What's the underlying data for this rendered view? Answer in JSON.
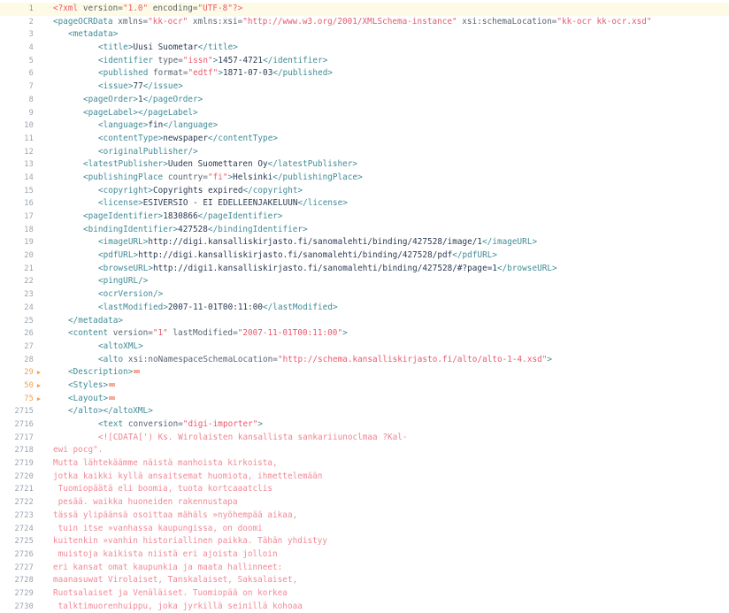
{
  "editor": {
    "name": "xml-code-viewer",
    "language": "XML",
    "active_line": 1,
    "colors": {
      "background": "#ffffff",
      "active_line_background": "#fdfbe6",
      "gutter_text": "#9aa3ad",
      "folded_gutter_text": "#f0a14a",
      "tag": "#3f8b96",
      "attribute_name": "#5a6470",
      "attribute_value": "#e8596b",
      "text_content": "#2b3a52",
      "raw_text": "#f08a96"
    }
  },
  "lines": [
    {
      "number": "1",
      "active": true,
      "folded": false,
      "indent": 0,
      "tokens": [
        {
          "t": "pi",
          "s": "<?xml "
        },
        {
          "t": "attr",
          "s": "version="
        },
        {
          "t": "val",
          "s": "\"1.0\""
        },
        {
          "t": "attr",
          "s": " encoding="
        },
        {
          "t": "val",
          "s": "\"UTF-8\""
        },
        {
          "t": "pi",
          "s": "?>"
        }
      ]
    },
    {
      "number": "2",
      "active": false,
      "folded": false,
      "indent": 0,
      "tokens": [
        {
          "t": "tag",
          "s": "<pageOCRData "
        },
        {
          "t": "attr",
          "s": "xmlns="
        },
        {
          "t": "val",
          "s": "\"kk-ocr\""
        },
        {
          "t": "attr",
          "s": " xmlns:xsi="
        },
        {
          "t": "val",
          "s": "\"http://www.w3.org/2001/XMLSchema-instance\""
        },
        {
          "t": "attr",
          "s": " xsi:schemaLocation="
        },
        {
          "t": "val",
          "s": "\"kk-ocr kk-ocr.xsd\""
        }
      ]
    },
    {
      "number": "3",
      "active": false,
      "folded": false,
      "indent": 1,
      "tokens": [
        {
          "t": "tag",
          "s": "<metadata>"
        }
      ]
    },
    {
      "number": "4",
      "active": false,
      "folded": false,
      "indent": 3,
      "tokens": [
        {
          "t": "tag",
          "s": "<title>"
        },
        {
          "t": "txt",
          "s": "Uusi Suometar"
        },
        {
          "t": "tag",
          "s": "</title>"
        }
      ]
    },
    {
      "number": "5",
      "active": false,
      "folded": false,
      "indent": 3,
      "tokens": [
        {
          "t": "tag",
          "s": "<identifier "
        },
        {
          "t": "attr",
          "s": "type="
        },
        {
          "t": "val",
          "s": "\"issn\""
        },
        {
          "t": "tag",
          "s": ">"
        },
        {
          "t": "txt",
          "s": "1457-4721"
        },
        {
          "t": "tag",
          "s": "</identifier>"
        }
      ]
    },
    {
      "number": "6",
      "active": false,
      "folded": false,
      "indent": 3,
      "tokens": [
        {
          "t": "tag",
          "s": "<published "
        },
        {
          "t": "attr",
          "s": "format="
        },
        {
          "t": "val",
          "s": "\"edtf\""
        },
        {
          "t": "tag",
          "s": ">"
        },
        {
          "t": "txt",
          "s": "1871-07-03"
        },
        {
          "t": "tag",
          "s": "</published>"
        }
      ]
    },
    {
      "number": "7",
      "active": false,
      "folded": false,
      "indent": 3,
      "tokens": [
        {
          "t": "tag",
          "s": "<issue>"
        },
        {
          "t": "txt",
          "s": "77"
        },
        {
          "t": "tag",
          "s": "</issue>"
        }
      ]
    },
    {
      "number": "8",
      "active": false,
      "folded": false,
      "indent": 2,
      "tokens": [
        {
          "t": "tag",
          "s": "<pageOrder>"
        },
        {
          "t": "txt",
          "s": "1"
        },
        {
          "t": "tag",
          "s": "</pageOrder>"
        }
      ]
    },
    {
      "number": "9",
      "active": false,
      "folded": false,
      "indent": 2,
      "tokens": [
        {
          "t": "tag",
          "s": "<pageLabel>"
        },
        {
          "t": "tag",
          "s": "</pageLabel>"
        }
      ]
    },
    {
      "number": "10",
      "active": false,
      "folded": false,
      "indent": 3,
      "tokens": [
        {
          "t": "tag",
          "s": "<language>"
        },
        {
          "t": "txt",
          "s": "fin"
        },
        {
          "t": "tag",
          "s": "</language>"
        }
      ]
    },
    {
      "number": "11",
      "active": false,
      "folded": false,
      "indent": 3,
      "tokens": [
        {
          "t": "tag",
          "s": "<contentType>"
        },
        {
          "t": "txt",
          "s": "newspaper"
        },
        {
          "t": "tag",
          "s": "</contentType>"
        }
      ]
    },
    {
      "number": "12",
      "active": false,
      "folded": false,
      "indent": 3,
      "tokens": [
        {
          "t": "tag",
          "s": "<originalPublisher/>"
        }
      ]
    },
    {
      "number": "13",
      "active": false,
      "folded": false,
      "indent": 2,
      "tokens": [
        {
          "t": "tag",
          "s": "<latestPublisher>"
        },
        {
          "t": "txt",
          "s": "Uuden Suomettaren Oy"
        },
        {
          "t": "tag",
          "s": "</latestPublisher>"
        }
      ]
    },
    {
      "number": "14",
      "active": false,
      "folded": false,
      "indent": 2,
      "tokens": [
        {
          "t": "tag",
          "s": "<publishingPlace "
        },
        {
          "t": "attr",
          "s": "country="
        },
        {
          "t": "val",
          "s": "\"fi\""
        },
        {
          "t": "tag",
          "s": ">"
        },
        {
          "t": "txt",
          "s": "Helsinki"
        },
        {
          "t": "tag",
          "s": "</publishingPlace>"
        }
      ]
    },
    {
      "number": "15",
      "active": false,
      "folded": false,
      "indent": 3,
      "tokens": [
        {
          "t": "tag",
          "s": "<copyright>"
        },
        {
          "t": "txt",
          "s": "Copyrights expired"
        },
        {
          "t": "tag",
          "s": "</copyright>"
        }
      ]
    },
    {
      "number": "16",
      "active": false,
      "folded": false,
      "indent": 3,
      "tokens": [
        {
          "t": "tag",
          "s": "<license>"
        },
        {
          "t": "txt",
          "s": "ESIVERSIO - EI EDELLEENJAKELUUN"
        },
        {
          "t": "tag",
          "s": "</license>"
        }
      ]
    },
    {
      "number": "17",
      "active": false,
      "folded": false,
      "indent": 2,
      "tokens": [
        {
          "t": "tag",
          "s": "<pageIdentifier>"
        },
        {
          "t": "txt",
          "s": "1830866"
        },
        {
          "t": "tag",
          "s": "</pageIdentifier>"
        }
      ]
    },
    {
      "number": "18",
      "active": false,
      "folded": false,
      "indent": 2,
      "tokens": [
        {
          "t": "tag",
          "s": "<bindingIdentifier>"
        },
        {
          "t": "txt",
          "s": "427528"
        },
        {
          "t": "tag",
          "s": "</bindingIdentifier>"
        }
      ]
    },
    {
      "number": "19",
      "active": false,
      "folded": false,
      "indent": 3,
      "tokens": [
        {
          "t": "tag",
          "s": "<imageURL>"
        },
        {
          "t": "txt",
          "s": "http://digi.kansalliskirjasto.fi/sanomalehti/binding/427528/image/1"
        },
        {
          "t": "tag",
          "s": "</imageURL>"
        }
      ]
    },
    {
      "number": "20",
      "active": false,
      "folded": false,
      "indent": 3,
      "tokens": [
        {
          "t": "tag",
          "s": "<pdfURL>"
        },
        {
          "t": "txt",
          "s": "http://digi.kansalliskirjasto.fi/sanomalehti/binding/427528/pdf"
        },
        {
          "t": "tag",
          "s": "</pdfURL>"
        }
      ]
    },
    {
      "number": "21",
      "active": false,
      "folded": false,
      "indent": 3,
      "tokens": [
        {
          "t": "tag",
          "s": "<browseURL>"
        },
        {
          "t": "txt",
          "s": "http://digi1.kansalliskirjasto.fi/sanomalehti/binding/427528/#?page=1"
        },
        {
          "t": "tag",
          "s": "</browseURL>"
        }
      ]
    },
    {
      "number": "22",
      "active": false,
      "folded": false,
      "indent": 3,
      "tokens": [
        {
          "t": "tag",
          "s": "<pingURL/>"
        }
      ]
    },
    {
      "number": "23",
      "active": false,
      "folded": false,
      "indent": 3,
      "tokens": [
        {
          "t": "tag",
          "s": "<ocrVersion/>"
        }
      ]
    },
    {
      "number": "24",
      "active": false,
      "folded": false,
      "indent": 3,
      "tokens": [
        {
          "t": "tag",
          "s": "<lastModified>"
        },
        {
          "t": "txt",
          "s": "2007-11-01T00:11:00"
        },
        {
          "t": "tag",
          "s": "</lastModified>"
        }
      ]
    },
    {
      "number": "25",
      "active": false,
      "folded": false,
      "indent": 1,
      "tokens": [
        {
          "t": "tag",
          "s": "</metadata>"
        }
      ]
    },
    {
      "number": "26",
      "active": false,
      "folded": false,
      "indent": 1,
      "tokens": [
        {
          "t": "tag",
          "s": "<content "
        },
        {
          "t": "attr",
          "s": "version="
        },
        {
          "t": "val",
          "s": "\"1\""
        },
        {
          "t": "attr",
          "s": " lastModified="
        },
        {
          "t": "val",
          "s": "\"2007-11-01T00:11:00\""
        },
        {
          "t": "tag",
          "s": ">"
        }
      ]
    },
    {
      "number": "27",
      "active": false,
      "folded": false,
      "indent": 3,
      "tokens": [
        {
          "t": "tag",
          "s": "<altoXML>"
        }
      ]
    },
    {
      "number": "28",
      "active": false,
      "folded": false,
      "indent": 3,
      "tokens": [
        {
          "t": "tag",
          "s": "<alto "
        },
        {
          "t": "attr",
          "s": "xsi:noNamespaceSchemaLocation="
        },
        {
          "t": "val",
          "s": "\"http://schema.kansalliskirjasto.fi/alto/alto-1-4.xsd\""
        },
        {
          "t": "tag",
          "s": ">"
        }
      ]
    },
    {
      "number": "29",
      "active": false,
      "folded": true,
      "indent": 1,
      "tokens": [
        {
          "t": "tag",
          "s": "<Description>"
        }
      ]
    },
    {
      "number": "50",
      "active": false,
      "folded": true,
      "indent": 1,
      "tokens": [
        {
          "t": "tag",
          "s": "<Styles>"
        }
      ]
    },
    {
      "number": "75",
      "active": false,
      "folded": true,
      "indent": 1,
      "tokens": [
        {
          "t": "tag",
          "s": "<Layout>"
        }
      ]
    },
    {
      "number": "2715",
      "active": false,
      "folded": false,
      "indent": 1,
      "tokens": [
        {
          "t": "tag",
          "s": "</alto></altoXML>"
        }
      ]
    },
    {
      "number": "2716",
      "active": false,
      "folded": false,
      "indent": 3,
      "tokens": [
        {
          "t": "tag",
          "s": "<text "
        },
        {
          "t": "attr",
          "s": "conversion="
        },
        {
          "t": "val",
          "s": "\"digi-importer\""
        },
        {
          "t": "tag",
          "s": ">"
        }
      ]
    },
    {
      "number": "2717",
      "active": false,
      "folded": false,
      "indent": 3,
      "tokens": [
        {
          "t": "cdata",
          "s": "<![CDATA[') Ks. Wirolaisten kansallista sankariiunoclmaa ?Kal-"
        }
      ]
    },
    {
      "number": "2718",
      "active": false,
      "folded": false,
      "indent": 0,
      "tokens": [
        {
          "t": "plain",
          "s": "ewi pocg\"."
        }
      ]
    },
    {
      "number": "2719",
      "active": false,
      "folded": false,
      "indent": 0,
      "tokens": [
        {
          "t": "plain",
          "s": "Mutta lähtekäämme näistä manhoista kirkoista,"
        }
      ]
    },
    {
      "number": "2720",
      "active": false,
      "folded": false,
      "indent": 0,
      "tokens": [
        {
          "t": "plain",
          "s": "jotka kaikki kyllä ansaitsemat huomiota, ihmettelemään"
        }
      ]
    },
    {
      "number": "2721",
      "active": false,
      "folded": false,
      "indent": 0,
      "tokens": [
        {
          "t": "plain",
          "s": " Tuomiopäätä eli boomia, tuota kortcaaatclis"
        }
      ]
    },
    {
      "number": "2722",
      "active": false,
      "folded": false,
      "indent": 0,
      "tokens": [
        {
          "t": "plain",
          "s": " pesää. waikka huoneiden rakennustapa"
        }
      ]
    },
    {
      "number": "2723",
      "active": false,
      "folded": false,
      "indent": 0,
      "tokens": [
        {
          "t": "plain",
          "s": "tässä ylipäänsä osoittaa mähäls »nyöhempää aikaa,"
        }
      ]
    },
    {
      "number": "2724",
      "active": false,
      "folded": false,
      "indent": 0,
      "tokens": [
        {
          "t": "plain",
          "s": " tuin itse »vanhassa kaupungissa, on doomi"
        }
      ]
    },
    {
      "number": "2725",
      "active": false,
      "folded": false,
      "indent": 0,
      "tokens": [
        {
          "t": "plain",
          "s": "kuitenkin »vanhin historiallinen paikka. Tähän yhdistyy"
        }
      ]
    },
    {
      "number": "2726",
      "active": false,
      "folded": false,
      "indent": 0,
      "tokens": [
        {
          "t": "plain",
          "s": " muistoja kaikista niistä eri ajoista jolloin"
        }
      ]
    },
    {
      "number": "2727",
      "active": false,
      "folded": false,
      "indent": 0,
      "tokens": [
        {
          "t": "plain",
          "s": "eri kansat omat kaupunkia ja maata hallinneet:"
        }
      ]
    },
    {
      "number": "2728",
      "active": false,
      "folded": false,
      "indent": 0,
      "tokens": [
        {
          "t": "plain",
          "s": "maanasuwat Virolaiset, Tanskalaiset, Saksalaiset,"
        }
      ]
    },
    {
      "number": "2729",
      "active": false,
      "folded": false,
      "indent": 0,
      "tokens": [
        {
          "t": "plain",
          "s": "Ruotsalaiset ja Venäläiset. Tuomiopää on korkea"
        }
      ]
    },
    {
      "number": "2730",
      "active": false,
      "folded": false,
      "indent": 0,
      "tokens": [
        {
          "t": "plain",
          "s": " talktimuorenhuippu, joka jyrkillä seinillä kohoaa"
        }
      ]
    }
  ]
}
